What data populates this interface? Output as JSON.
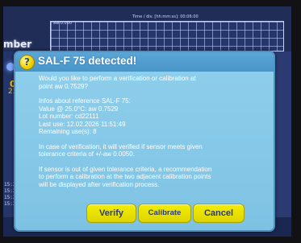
{
  "background": {
    "title_fragment": "mber",
    "value_primary": "0",
    "value_secondary": "23",
    "chart_axis_label": "Time / div. [hh:mm:ss]: 00:06:00",
    "chart_aw_label": "aw 0.050",
    "time_labels": [
      "15:2",
      "15:2",
      "15:2",
      "15:2"
    ]
  },
  "dialog": {
    "title": "SAL-F 75 detected!",
    "icon": "question-icon",
    "icon_glyph": "?",
    "question_lines": [
      "Would you like to perform a verification or calibration at",
      "point aw 0.7529?"
    ],
    "info_lines": [
      "Infos about reference SAL-F 75:",
      "Value @ 25.0°C: aw 0.7529",
      "Lot number: cd22111",
      "Last use: 12.02.2026 11:51:49",
      "Remaining use(s): 8"
    ],
    "verification_lines": [
      "In case of verification, it will verified if sensor meets given",
      "tolerance criteria of +/-aw 0.0050."
    ],
    "tolerance_lines": [
      "If sensor is out of given tolerance criteria, a recommendation",
      "to perform a calibration at the two adjacent calibration points",
      "will be displayed after verification process."
    ],
    "buttons": {
      "verify": "Verify",
      "calibrate": "Calibrate",
      "cancel": "Cancel"
    }
  },
  "colors": {
    "dialog_bg": "#8fcfec",
    "header_bg": "#4a95c8",
    "button_bg": "#f4ee00",
    "button_text": "#2c3a7a"
  }
}
